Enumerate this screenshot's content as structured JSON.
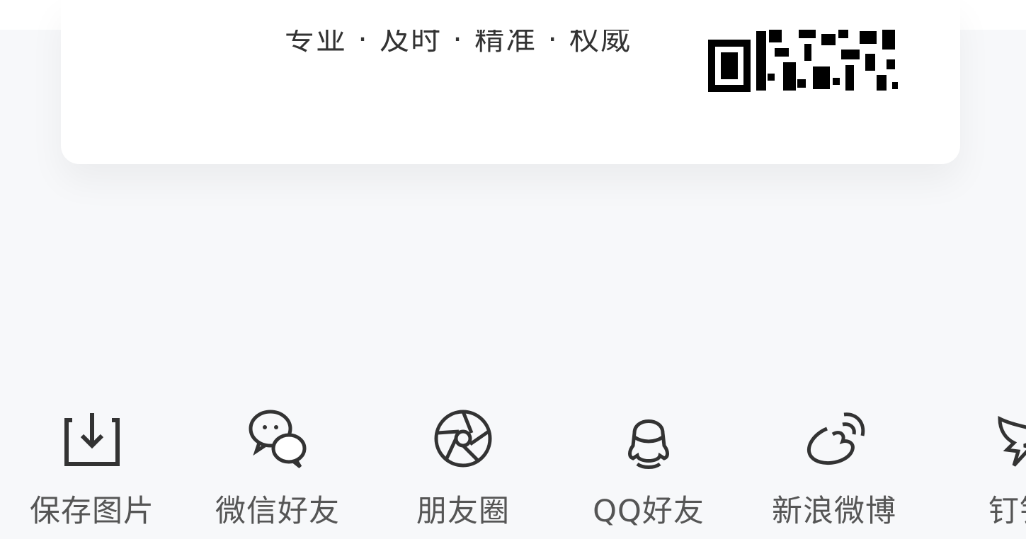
{
  "card": {
    "slogan": "专业 · 及时 · 精准 · 权威"
  },
  "share_bar": {
    "items": [
      {
        "label": "保存图片",
        "icon": "download-icon"
      },
      {
        "label": "微信好友",
        "icon": "wechat-icon"
      },
      {
        "label": "朋友圈",
        "icon": "moments-icon"
      },
      {
        "label": "QQ好友",
        "icon": "qq-icon"
      },
      {
        "label": "新浪微博",
        "icon": "weibo-icon"
      },
      {
        "label": "钉钉",
        "icon": "dingtalk-icon"
      }
    ]
  },
  "colors": {
    "background": "#f7f8fa",
    "card": "#ffffff",
    "icon": "#333333",
    "label": "#555555",
    "qr": "#000000"
  }
}
